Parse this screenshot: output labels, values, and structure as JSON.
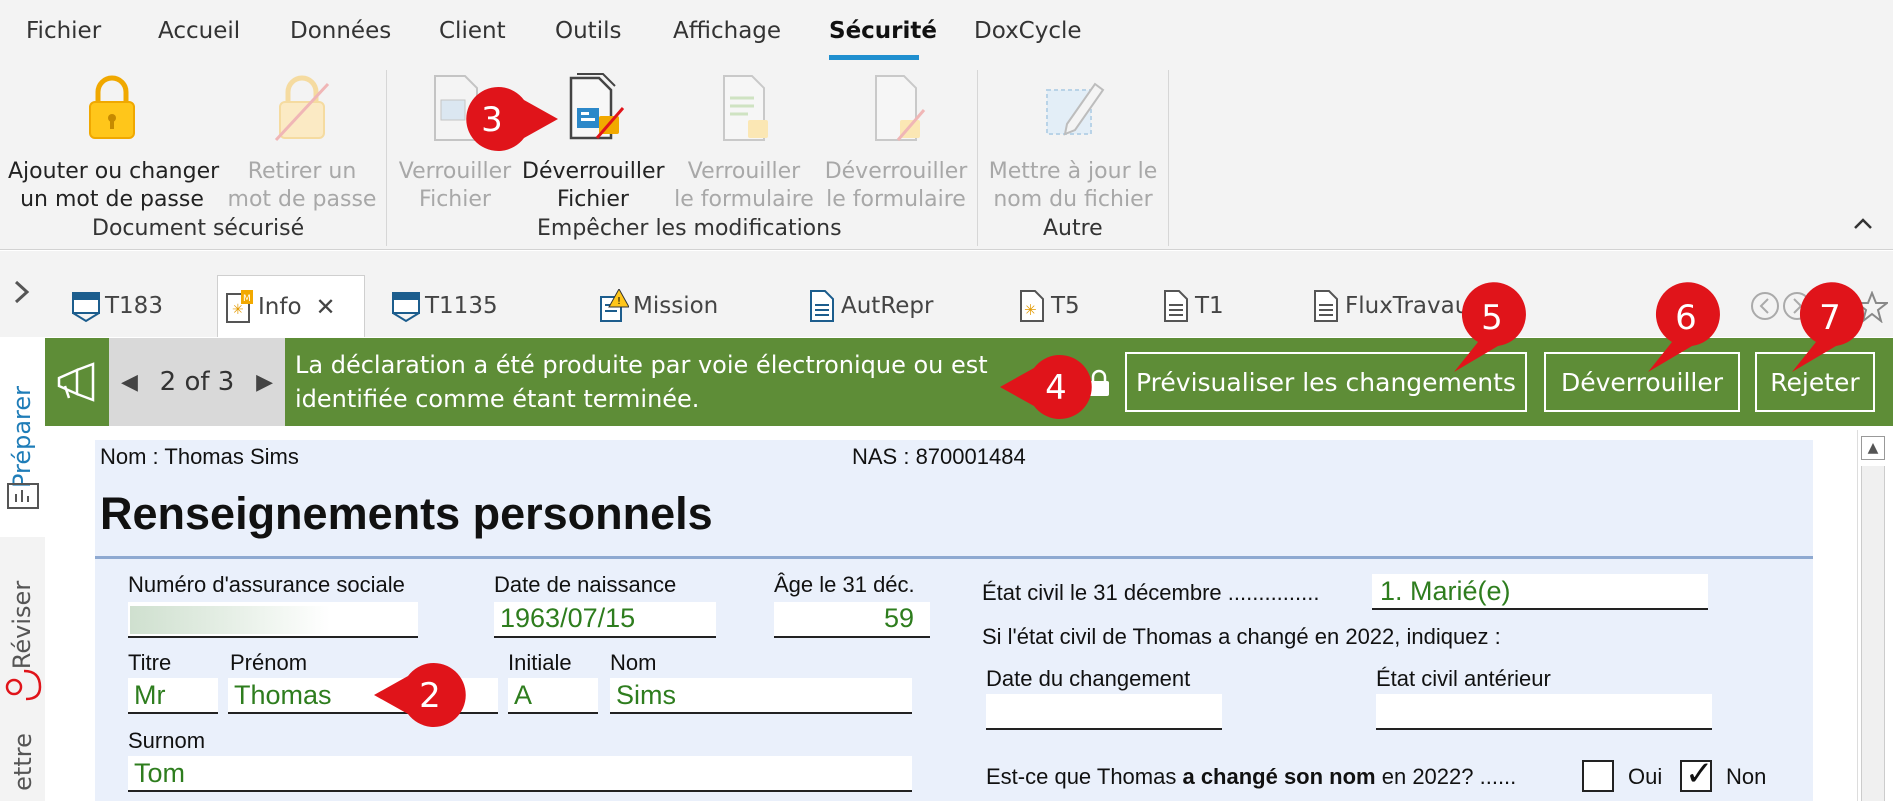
{
  "menu": {
    "items": [
      {
        "label": "Fichier"
      },
      {
        "label": "Accueil"
      },
      {
        "label": "Données"
      },
      {
        "label": "Client"
      },
      {
        "label": "Outils"
      },
      {
        "label": "Affichage"
      },
      {
        "label": "Sécurité",
        "active": true
      },
      {
        "label": "DoxCycle"
      }
    ]
  },
  "ribbon": {
    "groups": [
      {
        "label": "Document sécurisé"
      },
      {
        "label": "Empêcher les modifications"
      },
      {
        "label": "Autre"
      }
    ],
    "buttons": [
      {
        "line1": "Ajouter ou changer",
        "line2": "un mot de passe",
        "enabled": true
      },
      {
        "line1": "Retirer un",
        "line2": "mot de passe",
        "enabled": false
      },
      {
        "line1": "Verrouiller",
        "line2": "Fichier",
        "enabled": false
      },
      {
        "line1": "Déverrouiller",
        "line2": "Fichier",
        "enabled": true
      },
      {
        "line1": "Verrouiller",
        "line2": "le formulaire",
        "enabled": false
      },
      {
        "line1": "Déverrouiller",
        "line2": "le formulaire",
        "enabled": false
      },
      {
        "line1": "Mettre à jour le",
        "line2": "nom du fichier",
        "enabled": false
      }
    ]
  },
  "tabs": [
    {
      "label": "T183"
    },
    {
      "label": "Info",
      "active": true
    },
    {
      "label": "T1135"
    },
    {
      "label": "Mission"
    },
    {
      "label": "AutRepr"
    },
    {
      "label": "T5"
    },
    {
      "label": "T1"
    },
    {
      "label": "FluxTravaux"
    }
  ],
  "banner": {
    "pager": "2 of 3",
    "message_line1": "La déclaration a été produite par voie électronique ou est",
    "message_line2": "identifiée comme étant terminée.",
    "preview_button": "Prévisualiser les changements",
    "unlock_button": "Déverrouiller",
    "reject_button": "Rejeter"
  },
  "side_tabs": [
    {
      "label": "Préparer",
      "active": true
    },
    {
      "label": "Réviser"
    },
    {
      "label": "ettre"
    }
  ],
  "form": {
    "header_name": "Nom : Thomas Sims",
    "header_sin": "NAS : 870001484",
    "title": "Renseignements personnels",
    "sin_label": "Numéro d'assurance sociale",
    "dob_label": "Date de naissance",
    "dob_value": "1963/07/15",
    "age_label": "Âge le 31 déc.",
    "age_value": "59",
    "title_label": "Titre",
    "title_value": "Mr",
    "first_label": "Prénom",
    "first_value": "Thomas",
    "initial_label": "Initiale",
    "initial_value": "A",
    "last_label": "Nom",
    "last_value": "Sims",
    "nick_label": "Surnom",
    "nick_value": "Tom",
    "marital_label": "État civil le 31 décembre ...............",
    "marital_value": "1. Marié(e)",
    "change_note": "Si l'état civil de Thomas a changé en 2022, indiquez :",
    "change_date_label": "Date du changement",
    "prev_status_label": "État civil antérieur",
    "name_change_q_pre": "Est-ce que Thomas ",
    "name_change_q_bold": "a changé son nom",
    "name_change_q_post": " en 2022? ......",
    "yes_label": "Oui",
    "no_label": "Non",
    "checkmark": "✓"
  },
  "callouts": [
    "2",
    "3",
    "4",
    "5",
    "6",
    "7"
  ],
  "colors": {
    "banner_green": "#5e8d37",
    "accent_blue": "#1f8fcf",
    "field_value_green": "#2e7d1e",
    "callout_red": "#e0141a"
  }
}
